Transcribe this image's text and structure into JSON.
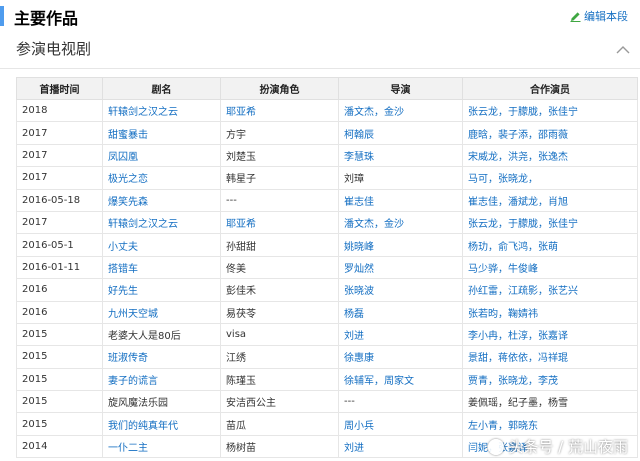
{
  "header": {
    "title": "主要作品",
    "edit_label": "编辑本段",
    "section_title": "参演电视剧"
  },
  "table": {
    "columns": [
      "首播时间",
      "剧名",
      "扮演角色",
      "导演",
      "合作演员"
    ],
    "rows": [
      {
        "date": "2018",
        "title": "轩辕剑之汉之云",
        "role": "耶亚希",
        "role_link": true,
        "director": "潘文杰，金沙",
        "director_link": true,
        "costars": "张云龙，于朦胧，张佳宁",
        "costars_link": true
      },
      {
        "date": "2017",
        "title": "甜蜜暴击",
        "role": "方宇",
        "role_link": false,
        "director": "柯翰辰",
        "director_link": true,
        "costars": "鹿晗，裴子添，邵雨薇",
        "costars_link": true
      },
      {
        "date": "2017",
        "title": "凤囚凰",
        "role": "刘楚玉",
        "role_link": false,
        "director": "李慧珠",
        "director_link": true,
        "costars": "宋威龙，洪尧，张逸杰",
        "costars_link": true
      },
      {
        "date": "2017",
        "title": "极光之恋",
        "role": "韩星子",
        "role_link": false,
        "director": "刘璋",
        "director_link": false,
        "costars": "马可，张晓龙，",
        "costars_link": true
      },
      {
        "date": "2016-05-18",
        "title": "爆笑先森",
        "role": "---",
        "role_link": false,
        "director": "崔志佳",
        "director_link": true,
        "costars": "崔志佳，潘斌龙，肖旭",
        "costars_link": true
      },
      {
        "date": "2017",
        "title": "轩辕剑之汉之云",
        "role": "耶亚希",
        "role_link": true,
        "director": "潘文杰，金沙",
        "director_link": true,
        "costars": "张云龙，于朦胧，张佳宁",
        "costars_link": true
      },
      {
        "date": "2016-05-1",
        "title": "小丈夫",
        "role": "孙甜甜",
        "role_link": false,
        "director": "姚晓峰",
        "director_link": true,
        "costars": "杨玏，俞飞鸿，张萌",
        "costars_link": true
      },
      {
        "date": "2016-01-11",
        "title": "搭错车",
        "role": "佟美",
        "role_link": false,
        "director": "罗灿然",
        "director_link": true,
        "costars": "马少骅，牛俊峰",
        "costars_link": true
      },
      {
        "date": "2016",
        "title": "好先生",
        "role": "彭佳禾",
        "role_link": false,
        "director": "张晓波",
        "director_link": true,
        "costars": "孙红雷，江疏影，张艺兴",
        "costars_link": true
      },
      {
        "date": "2016",
        "title": "九州天空城",
        "role": "易茯苓",
        "role_link": false,
        "director": "杨磊",
        "director_link": true,
        "costars": "张若昀，鞠婧祎",
        "costars_link": true
      },
      {
        "date": "2015",
        "title": "老婆大人是80后",
        "title_link": false,
        "role": "visa",
        "role_link": false,
        "director": "刘进",
        "director_link": true,
        "costars": "李小冉，杜淳，张嘉译",
        "costars_link": true
      },
      {
        "date": "2015",
        "title": "班淑传奇",
        "role": "江绣",
        "role_link": false,
        "director": "徐惠康",
        "director_link": true,
        "costars": "景甜，蒋依依，冯祥琨",
        "costars_link": true
      },
      {
        "date": "2015",
        "title": "妻子的谎言",
        "role": "陈瑾玉",
        "role_link": false,
        "director": "徐辅军，周家文",
        "director_link": true,
        "costars": "贾青，张晓龙，李茂",
        "costars_link": true
      },
      {
        "date": "2015",
        "title": "旋风魔法乐园",
        "title_link": false,
        "role": "安洁西公主",
        "role_link": false,
        "director": "---",
        "director_link": false,
        "costars": "姜佩瑶，纪子墨，杨雪",
        "costars_link": false
      },
      {
        "date": "2015",
        "title": "我们的纯真年代",
        "role": "苗瓜",
        "role_link": false,
        "director": "周小兵",
        "director_link": true,
        "costars": "左小青，郭晓东",
        "costars_link": true
      },
      {
        "date": "2014",
        "title": "一仆二主",
        "role": "杨树苗",
        "role_link": false,
        "director": "刘进",
        "director_link": true,
        "costars": "闫妮，张嘉译",
        "costars_link": true
      }
    ]
  },
  "watermark": {
    "text": "头条号 / 荒山夜雨"
  },
  "colors": {
    "link": "#136ec2",
    "header_bg": "#f2f2f2",
    "accent_bar": "#4f9cee",
    "edit_icon": "#3fa742"
  },
  "icons": {
    "edit": "pencil-icon",
    "collapse": "chevron-up-icon"
  }
}
